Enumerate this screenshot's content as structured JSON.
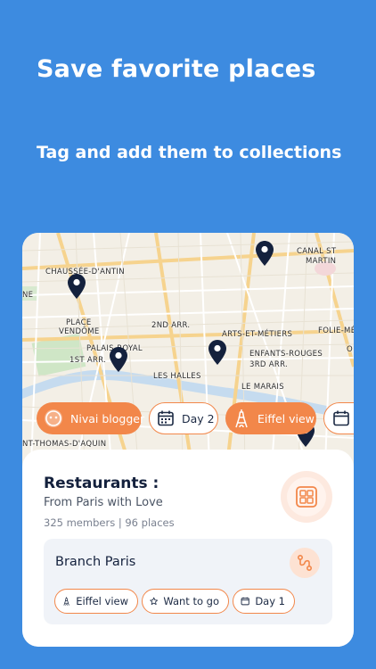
{
  "header": {
    "headline": "Save favorite places",
    "subhead": "Tag and add them to collections"
  },
  "map": {
    "labels": [
      "CANAL ST",
      "MARTIN",
      "CHAUSSÉE-D'ANTIN",
      "NE",
      "PLACE",
      "VENDÔME",
      "2ND ARR.",
      "FOLIE-MÉ",
      "ARTS-ET-MÉTIERS",
      "PALAIS-ROYAL",
      "1ST ARR.",
      "ENFANTS-ROUGES",
      "3RD ARR.",
      "LES HALLES",
      "LE MARAIS",
      "NT-THOMAS-D'AQUIN",
      "O"
    ]
  },
  "chips": [
    {
      "label": "Nivai blogger",
      "icon": "blogger-avatar-icon",
      "style": "orange"
    },
    {
      "label": "Day 2",
      "icon": "calendar-icon",
      "style": "white"
    },
    {
      "label": "Eiffel view",
      "icon": "eiffel-tower-icon",
      "style": "orange"
    }
  ],
  "collection": {
    "title": "Restaurants :",
    "subtitle": "From Paris with Love",
    "meta": "325 members | 96 places"
  },
  "place_card": {
    "title": "Branch Paris",
    "tags": [
      {
        "label": "Eiffel view",
        "icon": "eiffel-tower-icon"
      },
      {
        "label": "Want to go",
        "icon": "star-icon"
      },
      {
        "label": "Day 1",
        "icon": "calendar-icon"
      }
    ]
  },
  "colors": {
    "background": "#3d8be0",
    "accent": "#f2874a",
    "pin": "#14213d"
  }
}
